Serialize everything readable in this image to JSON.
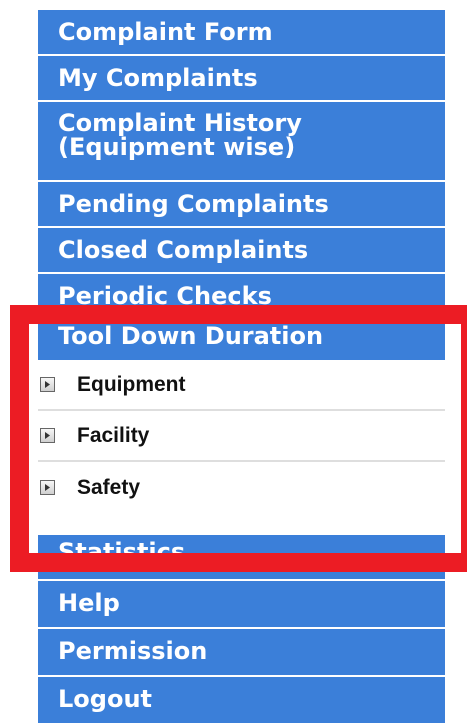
{
  "menu": {
    "items": [
      {
        "label": "Complaint Form"
      },
      {
        "label": "My Complaints"
      },
      {
        "label_line1": "Complaint History",
        "label_line2": "(Equipment wise)"
      },
      {
        "label": "Pending Complaints"
      },
      {
        "label": "Closed Complaints"
      },
      {
        "label": "Periodic Checks"
      },
      {
        "label": "Tool Down Duration"
      },
      {
        "label": "Statistics"
      },
      {
        "label": "Help"
      },
      {
        "label": "Permission"
      },
      {
        "label": "Logout"
      }
    ],
    "submenu": [
      {
        "label": "Equipment",
        "icon": "expand-icon"
      },
      {
        "label": "Facility",
        "icon": "expand-icon"
      },
      {
        "label": "Safety",
        "icon": "expand-icon"
      }
    ]
  },
  "colors": {
    "menu_bg": "#3b7fd9",
    "highlight": "#ec1c24"
  }
}
